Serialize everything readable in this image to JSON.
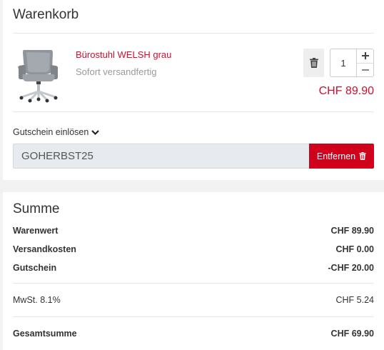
{
  "cart": {
    "title": "Warenkorb",
    "item": {
      "name": "Bürostuhl WELSH grau",
      "availability": "Sofort versandfertig",
      "quantity": "1",
      "price": "CHF 89.90"
    }
  },
  "voucher": {
    "toggle_label": "Gutschein einlösen",
    "code": "GOHERBST25",
    "remove_label": "Entfernen"
  },
  "summary": {
    "title": "Summe",
    "rows": [
      {
        "label": "Warenwert",
        "value": "CHF 89.90"
      },
      {
        "label": "Versandkosten",
        "value": "CHF 0.00"
      },
      {
        "label": "Gutschein",
        "value": "-CHF 20.00"
      },
      {
        "label": "MwSt. 8.1%",
        "value": "CHF 5.24"
      },
      {
        "label": "Gesamtsumme",
        "value": "CHF 69.90"
      }
    ]
  },
  "colors": {
    "accent": "#d0021b",
    "price": "#cc1030"
  },
  "icons": [
    "trash-icon",
    "chevron-down-icon",
    "plus-icon",
    "minus-icon"
  ]
}
